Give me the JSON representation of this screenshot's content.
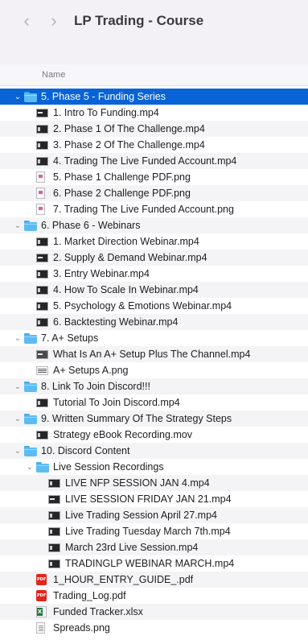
{
  "window": {
    "title": "LP Trading - Course",
    "back_glyph": "‹",
    "forward_glyph": "›"
  },
  "column_header": {
    "name": "Name"
  },
  "colors": {
    "selection": "#0863d6",
    "folder": "#5bbcf2",
    "pdf": "#e0271e"
  },
  "rows": [
    {
      "label": "5. Phase 5 - Funding Series",
      "kind": "folder",
      "level": 0,
      "expanded": true,
      "selected": true
    },
    {
      "label": "1. Intro To Funding.mp4",
      "kind": "video-w",
      "level": 1
    },
    {
      "label": "2. Phase 1 Of The Challenge.mp4",
      "kind": "video",
      "level": 1
    },
    {
      "label": "3. Phase 2 Of The Challenge.mp4",
      "kind": "video",
      "level": 1
    },
    {
      "label": "4. Trading The Live Funded Account.mp4",
      "kind": "video",
      "level": 1
    },
    {
      "label": "5. Phase 1 Challenge PDF.png",
      "kind": "image",
      "level": 1
    },
    {
      "label": "6. Phase 2 Challenge PDF.png",
      "kind": "image",
      "level": 1
    },
    {
      "label": "7. Trading The Live Funded Account.png",
      "kind": "image",
      "level": 1
    },
    {
      "label": "6. Phase 6 - Webinars",
      "kind": "folder",
      "level": 0,
      "expanded": true
    },
    {
      "label": "1. Market Direction Webinar.mp4",
      "kind": "video",
      "level": 1
    },
    {
      "label": "2. Supply & Demand Webinar.mp4",
      "kind": "video-w",
      "level": 1
    },
    {
      "label": "3. Entry Webinar.mp4",
      "kind": "video",
      "level": 1
    },
    {
      "label": "4. How To Scale In Webinar.mp4",
      "kind": "video",
      "level": 1
    },
    {
      "label": "5. Psychology & Emotions Webinar.mp4",
      "kind": "video",
      "level": 1
    },
    {
      "label": "6. Backtesting Webinar.mp4",
      "kind": "video",
      "level": 1
    },
    {
      "label": "7. A+ Setups",
      "kind": "folder",
      "level": 0,
      "expanded": true
    },
    {
      "label": "What Is An A+ Setup Plus The Channel.mp4",
      "kind": "video-flat",
      "level": 1
    },
    {
      "label": "A+ Setups A.png",
      "kind": "image-wide",
      "level": 1
    },
    {
      "label": "8. Link To Join Discord!!!",
      "kind": "folder",
      "level": 0,
      "expanded": true
    },
    {
      "label": "Tutorial To Join Discord.mp4",
      "kind": "video",
      "level": 1
    },
    {
      "label": "9. Written Summary Of The Strategy Steps",
      "kind": "folder",
      "level": 0,
      "expanded": true
    },
    {
      "label": "Strategy eBook Recording.mov",
      "kind": "video",
      "level": 1
    },
    {
      "label": "10. Discord Content",
      "kind": "folder",
      "level": 0,
      "expanded": true
    },
    {
      "label": "Live Session Recordings",
      "kind": "folder",
      "level": 1,
      "expanded": true
    },
    {
      "label": "LIVE NFP SESSION JAN 4.mp4",
      "kind": "video",
      "level": 2
    },
    {
      "label": "LIVE SESSION FRIDAY JAN 21.mp4",
      "kind": "video-w",
      "level": 2
    },
    {
      "label": "Live Trading Session April 27.mp4",
      "kind": "video",
      "level": 2
    },
    {
      "label": "Live Trading Tuesday March 7th.mp4",
      "kind": "video",
      "level": 2
    },
    {
      "label": "March 23rd Live Session.mp4",
      "kind": "video",
      "level": 2
    },
    {
      "label": "TRADINGLP WEBINAR MARCH.mp4",
      "kind": "video",
      "level": 2
    },
    {
      "label": "1_HOUR_ENTRY_GUIDE_.pdf",
      "kind": "pdf",
      "level": 1
    },
    {
      "label": "Trading_Log.pdf",
      "kind": "pdf",
      "level": 1
    },
    {
      "label": "Funded Tracker.xlsx",
      "kind": "xlsx",
      "level": 1
    },
    {
      "label": "Spreads.png",
      "kind": "doc",
      "level": 1
    }
  ]
}
